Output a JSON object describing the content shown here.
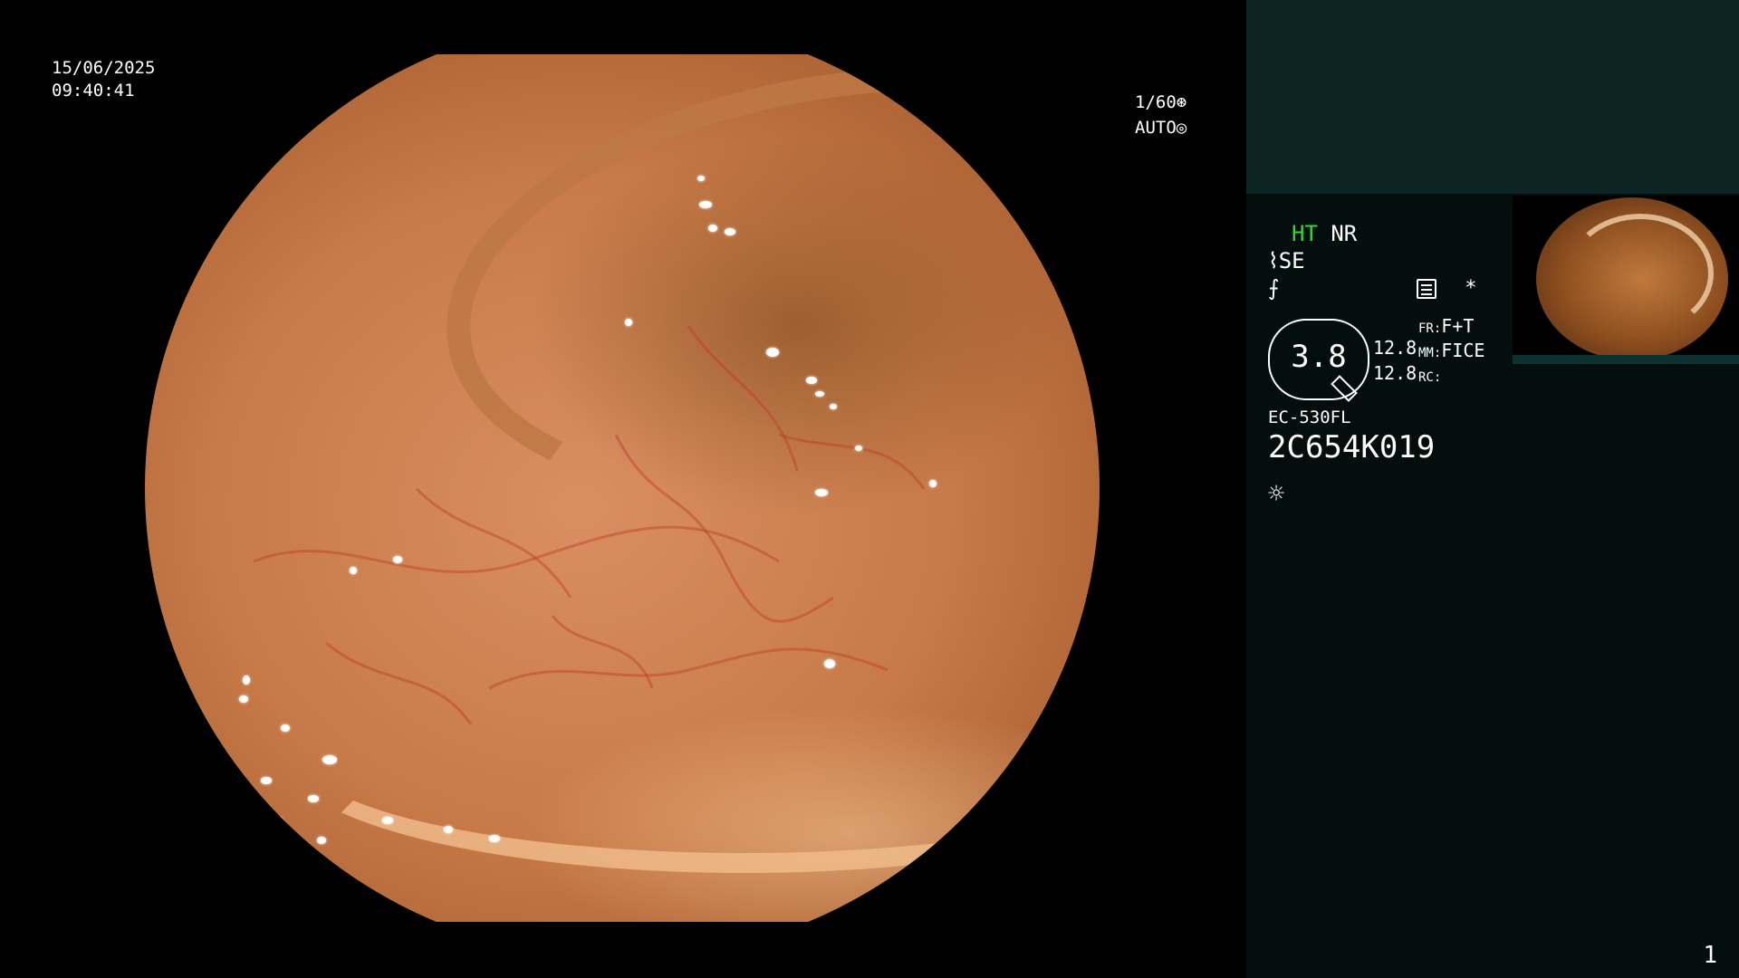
{
  "overlay": {
    "date": "15/06/2025",
    "time": "09:40:41",
    "shutter": "1/60",
    "shutter_icon": "aperture-icon",
    "exposure": "AUTO",
    "exposure_icon": "iris-icon"
  },
  "panel": {
    "mode_ht": "HT",
    "mode_nr": "NR",
    "se_label": "SE",
    "se_icon": "curve-enhance-icon",
    "enhance_icon": "sharpness-icon",
    "settings_icon": "menu-box-icon",
    "star": "*",
    "gauge_value": "3.8",
    "value_1": "12.8",
    "value_2": "12.8",
    "fr_label": "FR:",
    "fr_value": "F+T",
    "mm_label": "MM:",
    "mm_value": "FICE",
    "rc_label": "RC:",
    "scope_model": "EC-530FL",
    "serial": "2C654K019",
    "light_icon": "sun-icon",
    "page_number": "1"
  },
  "thumbnail": {
    "label": "previous-capture-thumbnail"
  }
}
